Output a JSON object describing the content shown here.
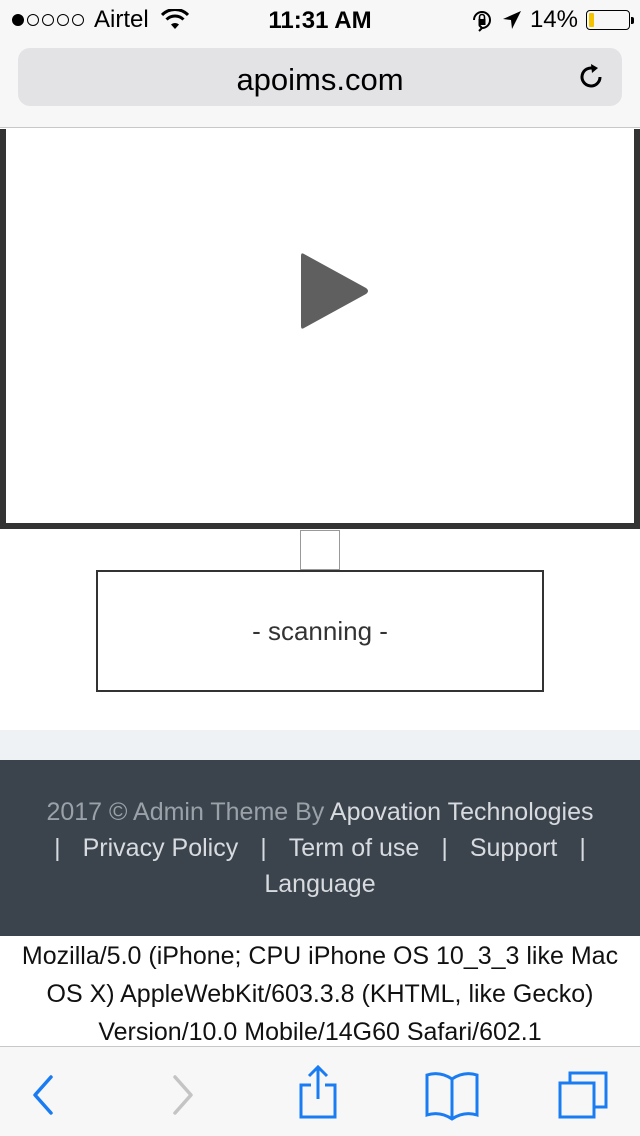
{
  "status_bar": {
    "carrier": "Airtel",
    "time": "11:31 AM",
    "battery_percent": "14%",
    "battery_level": 0.14,
    "signal_bars": 1,
    "icons": [
      "wifi-icon",
      "orientation-lock-icon",
      "location-arrow-icon",
      "battery-icon"
    ]
  },
  "browser": {
    "url": "apoims.com",
    "reload_icon": "reload-icon"
  },
  "player": {
    "play_icon": "play-icon"
  },
  "scanner": {
    "status": "- scanning -"
  },
  "footer": {
    "copyright_prefix": "2017 © Admin Theme By",
    "company": "Apovation Technologies",
    "separator": "|",
    "links": [
      "Privacy Policy",
      "Term of use",
      "Support",
      "Language"
    ]
  },
  "user_agent": "Mozilla/5.0 (iPhone; CPU iPhone OS 10_3_3 like Mac OS X) AppleWebKit/603.3.8 (KHTML, like Gecko) Version/10.0 Mobile/14G60 Safari/602.1",
  "toolbar": {
    "icons": [
      "back-icon",
      "forward-icon",
      "share-icon",
      "bookmarks-icon",
      "tabs-icon"
    ]
  },
  "colors": {
    "accent": "#1a7cf2",
    "footer_bg": "#3b434c",
    "battery": "#f5c400"
  }
}
